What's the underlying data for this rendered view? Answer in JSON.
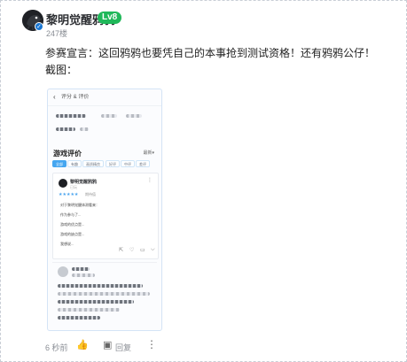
{
  "comment": {
    "author": "黎明觉醒鸦鸦",
    "level": "Lv8",
    "floor": "247楼",
    "text": "参赛宣言：这回鸦鸦也要凭自己的本事抢到测试资格！还有鸦鸦公仔！",
    "screenshot_label": "截图：",
    "time": "6 秒前",
    "reply": "回复"
  },
  "screenshot": {
    "back": "‹",
    "title": "评分 & 评价",
    "section_title": "游戏评价",
    "sort": "最新▾",
    "tabs": [
      "全部",
      "有趣",
      "画质精良",
      "好评",
      "中评",
      "差评"
    ],
    "review": {
      "name": "黎明觉醒鸦鸦",
      "meta": "已玩",
      "stars": "★★★★★",
      "star_note": "期待值",
      "lines": [
        "对于黎明觉醒体测看来：",
        "作为参与了...",
        "游戏的优点是...",
        "游戏的缺点是...",
        "我想说..."
      ]
    }
  }
}
